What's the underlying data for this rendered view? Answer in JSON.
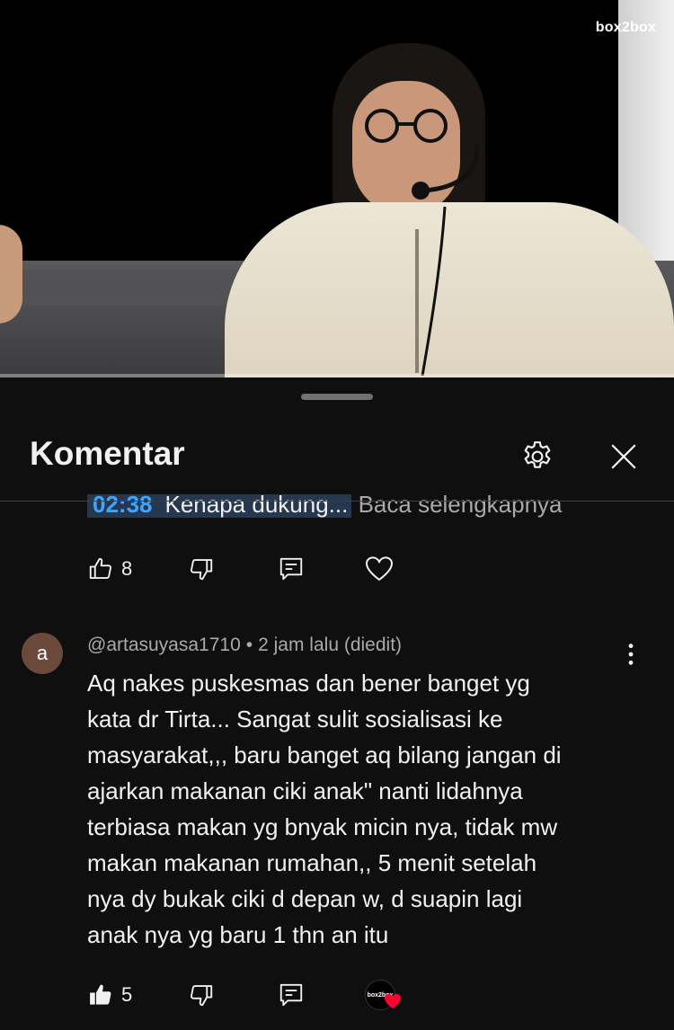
{
  "video": {
    "watermark": "box2box"
  },
  "sheet": {
    "title": "Komentar",
    "settings_icon": "gear-icon",
    "close_icon": "close-icon"
  },
  "previous_comment": {
    "timestamp": "02:38",
    "snippet": "Kenapa dukung...",
    "read_more": "Baca selengkapnya",
    "likes": "8"
  },
  "comment": {
    "avatar_letter": "a",
    "avatar_color": "#6b4a3b",
    "author": "@artasuyasa1710",
    "time": "2 jam lalu (diedit)",
    "lines": [
      "Aq nakes puskesmas dan bener banget yg",
      "kata dr Tirta... Sangat sulit sosialisasi ke",
      "masyarakat,,, baru banget aq bilang jangan di",
      "ajarkan makanan ciki anak\" nanti lidahnya",
      "terbiasa makan yg bnyak micin nya, tidak mw",
      "makan makanan rumahan,, 5 menit setelah",
      "nya dy bukak ciki d depan w, d suapin lagi",
      "anak nya yg baru 1 thn an itu"
    ],
    "likes": "5",
    "creator_avatar_label": "box2box",
    "heart_color": "#ff0033"
  }
}
